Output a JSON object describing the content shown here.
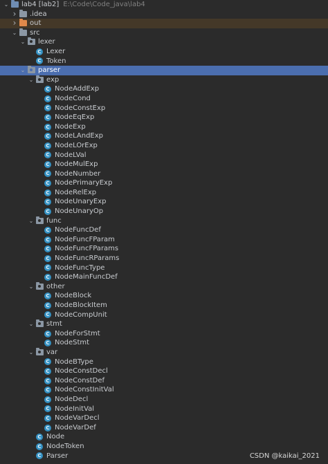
{
  "project": {
    "name": "lab4 [lab2]",
    "path": "E:\\Code\\Code_java\\lab4"
  },
  "tree": [
    {
      "label": "lab4 [lab2]",
      "path": "E:\\Code\\Code_java\\lab4",
      "kind": "project",
      "depth": 0,
      "expanded": true
    },
    {
      "label": ".idea",
      "kind": "folder",
      "depth": 1,
      "expanded": false
    },
    {
      "label": "out",
      "kind": "folder-excluded",
      "depth": 1,
      "expanded": false
    },
    {
      "label": "src",
      "kind": "folder",
      "depth": 1,
      "expanded": true
    },
    {
      "label": "lexer",
      "kind": "package",
      "depth": 2,
      "expanded": true
    },
    {
      "label": "Lexer",
      "kind": "class",
      "depth": 3
    },
    {
      "label": "Token",
      "kind": "class",
      "depth": 3
    },
    {
      "label": "parser",
      "kind": "package",
      "depth": 2,
      "expanded": true,
      "selected": true
    },
    {
      "label": "exp",
      "kind": "package",
      "depth": 3,
      "expanded": true
    },
    {
      "label": "NodeAddExp",
      "kind": "class",
      "depth": 4
    },
    {
      "label": "NodeCond",
      "kind": "class",
      "depth": 4
    },
    {
      "label": "NodeConstExp",
      "kind": "class",
      "depth": 4
    },
    {
      "label": "NodeEqExp",
      "kind": "class",
      "depth": 4
    },
    {
      "label": "NodeExp",
      "kind": "class",
      "depth": 4
    },
    {
      "label": "NodeLAndExp",
      "kind": "class",
      "depth": 4
    },
    {
      "label": "NodeLOrExp",
      "kind": "class",
      "depth": 4
    },
    {
      "label": "NodeLVal",
      "kind": "class",
      "depth": 4
    },
    {
      "label": "NodeMulExp",
      "kind": "class",
      "depth": 4
    },
    {
      "label": "NodeNumber",
      "kind": "class",
      "depth": 4
    },
    {
      "label": "NodePrimaryExp",
      "kind": "class",
      "depth": 4
    },
    {
      "label": "NodeRelExp",
      "kind": "class",
      "depth": 4
    },
    {
      "label": "NodeUnaryExp",
      "kind": "class",
      "depth": 4
    },
    {
      "label": "NodeUnaryOp",
      "kind": "class",
      "depth": 4
    },
    {
      "label": "func",
      "kind": "package",
      "depth": 3,
      "expanded": true
    },
    {
      "label": "NodeFuncDef",
      "kind": "class",
      "depth": 4
    },
    {
      "label": "NodeFuncFParam",
      "kind": "class",
      "depth": 4
    },
    {
      "label": "NodeFuncFParams",
      "kind": "class",
      "depth": 4
    },
    {
      "label": "NodeFuncRParams",
      "kind": "class",
      "depth": 4
    },
    {
      "label": "NodeFuncType",
      "kind": "class",
      "depth": 4
    },
    {
      "label": "NodeMainFuncDef",
      "kind": "class",
      "depth": 4
    },
    {
      "label": "other",
      "kind": "package",
      "depth": 3,
      "expanded": true
    },
    {
      "label": "NodeBlock",
      "kind": "class",
      "depth": 4
    },
    {
      "label": "NodeBlockItem",
      "kind": "class",
      "depth": 4
    },
    {
      "label": "NodeCompUnit",
      "kind": "class",
      "depth": 4
    },
    {
      "label": "stmt",
      "kind": "package",
      "depth": 3,
      "expanded": true
    },
    {
      "label": "NodeForStmt",
      "kind": "class",
      "depth": 4
    },
    {
      "label": "NodeStmt",
      "kind": "class",
      "depth": 4
    },
    {
      "label": "var",
      "kind": "package",
      "depth": 3,
      "expanded": true
    },
    {
      "label": "NodeBType",
      "kind": "class",
      "depth": 4
    },
    {
      "label": "NodeConstDecl",
      "kind": "class",
      "depth": 4
    },
    {
      "label": "NodeConstDef",
      "kind": "class",
      "depth": 4
    },
    {
      "label": "NodeConstInitVal",
      "kind": "class",
      "depth": 4
    },
    {
      "label": "NodeDecl",
      "kind": "class",
      "depth": 4
    },
    {
      "label": "NodeInitVal",
      "kind": "class",
      "depth": 4
    },
    {
      "label": "NodeVarDecl",
      "kind": "class",
      "depth": 4
    },
    {
      "label": "NodeVarDef",
      "kind": "class",
      "depth": 4
    },
    {
      "label": "Node",
      "kind": "class",
      "depth": 3
    },
    {
      "label": "NodeToken",
      "kind": "class",
      "depth": 3
    },
    {
      "label": "Parser",
      "kind": "class",
      "depth": 3
    }
  ],
  "icons": {
    "class_letter": "C",
    "expanded_arrow": "chevron-down-icon",
    "collapsed_arrow": "chevron-right-icon"
  },
  "colors": {
    "background": "#2b2b2b",
    "selection": "#4b6eaf",
    "class_icon": "#3592c4",
    "excluded_folder": "#e0894a"
  },
  "watermark": "CSDN @kaikai_2021"
}
